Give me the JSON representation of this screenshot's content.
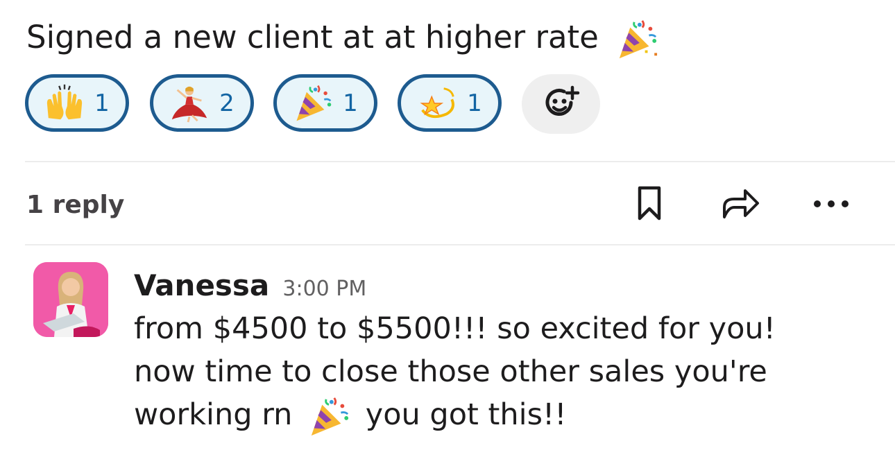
{
  "message": {
    "text": "Signed a new client at at higher rate",
    "emoji": "party-popper"
  },
  "reactions": [
    {
      "emoji": "raising-hands",
      "count": "1"
    },
    {
      "emoji": "dancer",
      "count": "2"
    },
    {
      "emoji": "party-popper",
      "count": "1"
    },
    {
      "emoji": "dizzy-star",
      "count": "1"
    }
  ],
  "add_reaction_icon": "emoji-add-icon",
  "thread": {
    "reply_count": "1 reply",
    "actions": [
      "bookmark-icon",
      "share-icon",
      "more-icon"
    ]
  },
  "reply": {
    "author": "Vanessa",
    "time": "3:00 PM",
    "lines": [
      "from $4500 to $5500!!! so excited for you!",
      "now time to close those other sales you're",
      "working rn",
      "you got this!!"
    ]
  },
  "colors": {
    "reaction_border": "#1d5b8f",
    "reaction_bg": "#e8f5fa",
    "reaction_count": "#1264a3",
    "avatar_bg": "#f15aa8"
  }
}
